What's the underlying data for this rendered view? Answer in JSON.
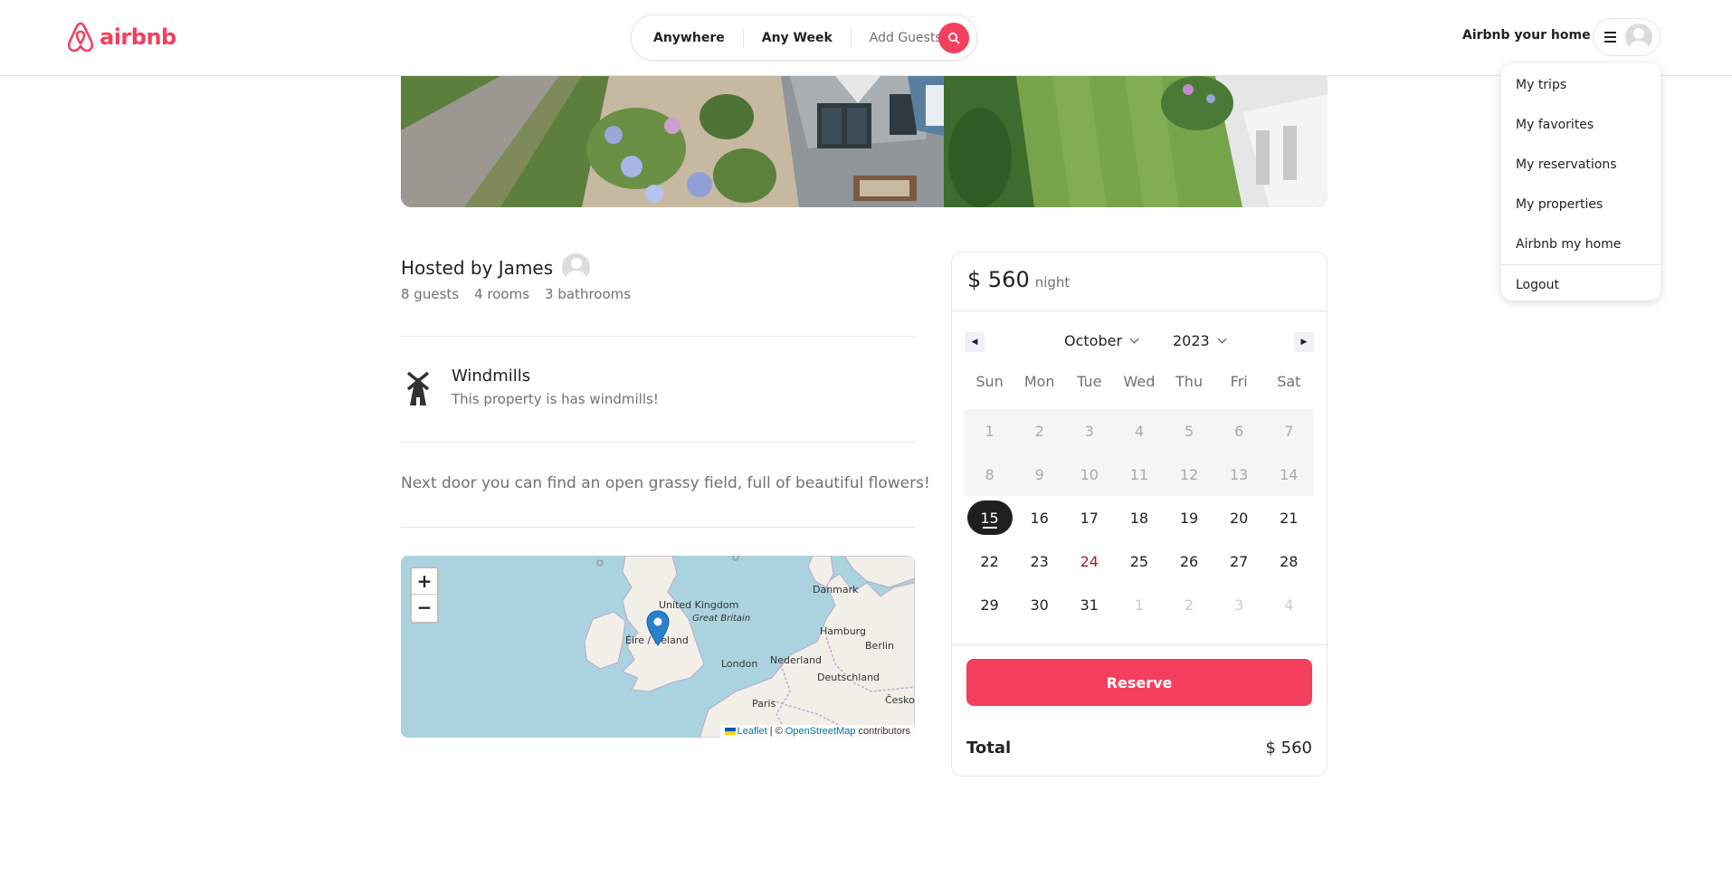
{
  "header": {
    "logo_text": "airbnb",
    "search": {
      "location": "Anywhere",
      "week": "Any Week",
      "guests": "Add Guests"
    },
    "host_link": "Airbnb your home"
  },
  "user_menu": {
    "items": [
      {
        "label": "My trips"
      },
      {
        "label": "My favorites"
      },
      {
        "label": "My reservations"
      },
      {
        "label": "My properties"
      },
      {
        "label": "Airbnb my home"
      }
    ],
    "logout": "Logout"
  },
  "listing": {
    "host_title": "Hosted by James",
    "stats": [
      "8 guests",
      "4 rooms",
      "3 bathrooms"
    ],
    "feature": {
      "icon": "windmill-icon",
      "title": "Windmills",
      "description": "This property is has windmills!"
    },
    "description": "Next door you can find an open grassy field, full of beautiful flowers!"
  },
  "map": {
    "zoom_in": "+",
    "zoom_out": "−",
    "labels": {
      "uk": "United Kingdom",
      "gb": "Great Britain",
      "ireland": "Éire / Ireland",
      "london": "London",
      "paris": "Paris",
      "danmark": "Danmark",
      "hamburg": "Hamburg",
      "berlin": "Berlin",
      "nederland": "Nederland",
      "deutschland": "Deutschland",
      "cesko": "Česko"
    },
    "attribution": {
      "leaflet": "Leaflet",
      "sep": " | © ",
      "osm": "OpenStreetMap",
      "contributors": " contributors"
    }
  },
  "booking": {
    "price": "$ 560",
    "unit": "night",
    "calendar": {
      "month": "October",
      "year": "2023",
      "weekdays": [
        "Sun",
        "Mon",
        "Tue",
        "Wed",
        "Thu",
        "Fri",
        "Sat"
      ],
      "weeks": [
        [
          "1",
          "2",
          "3",
          "4",
          "5",
          "6",
          "7"
        ],
        [
          "8",
          "9",
          "10",
          "11",
          "12",
          "13",
          "14"
        ],
        [
          "15",
          "16",
          "17",
          "18",
          "19",
          "20",
          "21"
        ],
        [
          "22",
          "23",
          "24",
          "25",
          "26",
          "27",
          "28"
        ],
        [
          "29",
          "30",
          "31",
          "1",
          "2",
          "3",
          "4"
        ]
      ],
      "selected": "15"
    },
    "reserve_label": "Reserve",
    "total_label": "Total",
    "total_value": "$ 560"
  },
  "colors": {
    "brand": "#f43f5e",
    "text": "#222222",
    "muted": "#717171"
  }
}
